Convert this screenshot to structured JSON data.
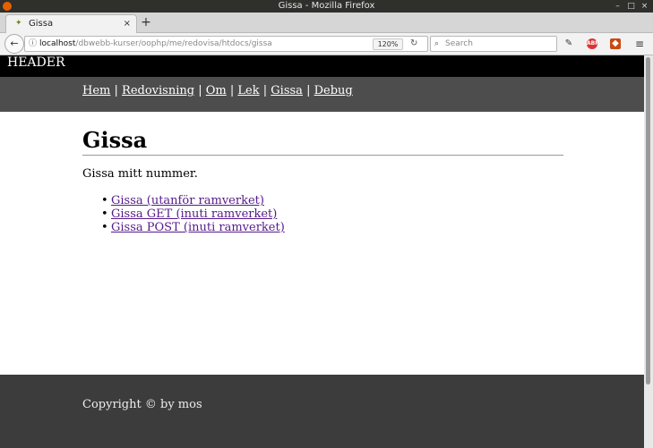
{
  "window": {
    "title": "Gissa - Mozilla Firefox"
  },
  "tab": {
    "title": "Gissa",
    "close": "×",
    "new_tab": "+"
  },
  "toolbar": {
    "back": "←",
    "url_host": "localhost",
    "url_path": "/dbwebb-kurser/oophp/me/redovisa/htdocs/gissa",
    "zoom": "120%",
    "reload": "↻",
    "search_placeholder": "Search"
  },
  "page": {
    "header": "HEADER",
    "nav": [
      "Hem",
      "Redovisning",
      "Om",
      "Lek",
      "Gissa",
      "Debug"
    ],
    "nav_separator": "|",
    "title": "Gissa",
    "intro": "Gissa mitt nummer.",
    "links": [
      "Gissa (utanför ramverket)",
      "Gissa GET (inuti ramverket)",
      "Gissa POST (inuti ramverket)"
    ],
    "footer": "Copyright © by mos"
  },
  "colors": {
    "header_bg": "#000000",
    "nav_bg": "#4d4d4d",
    "footer_bg": "#3c3c3c",
    "visited_link": "#551a8b"
  }
}
